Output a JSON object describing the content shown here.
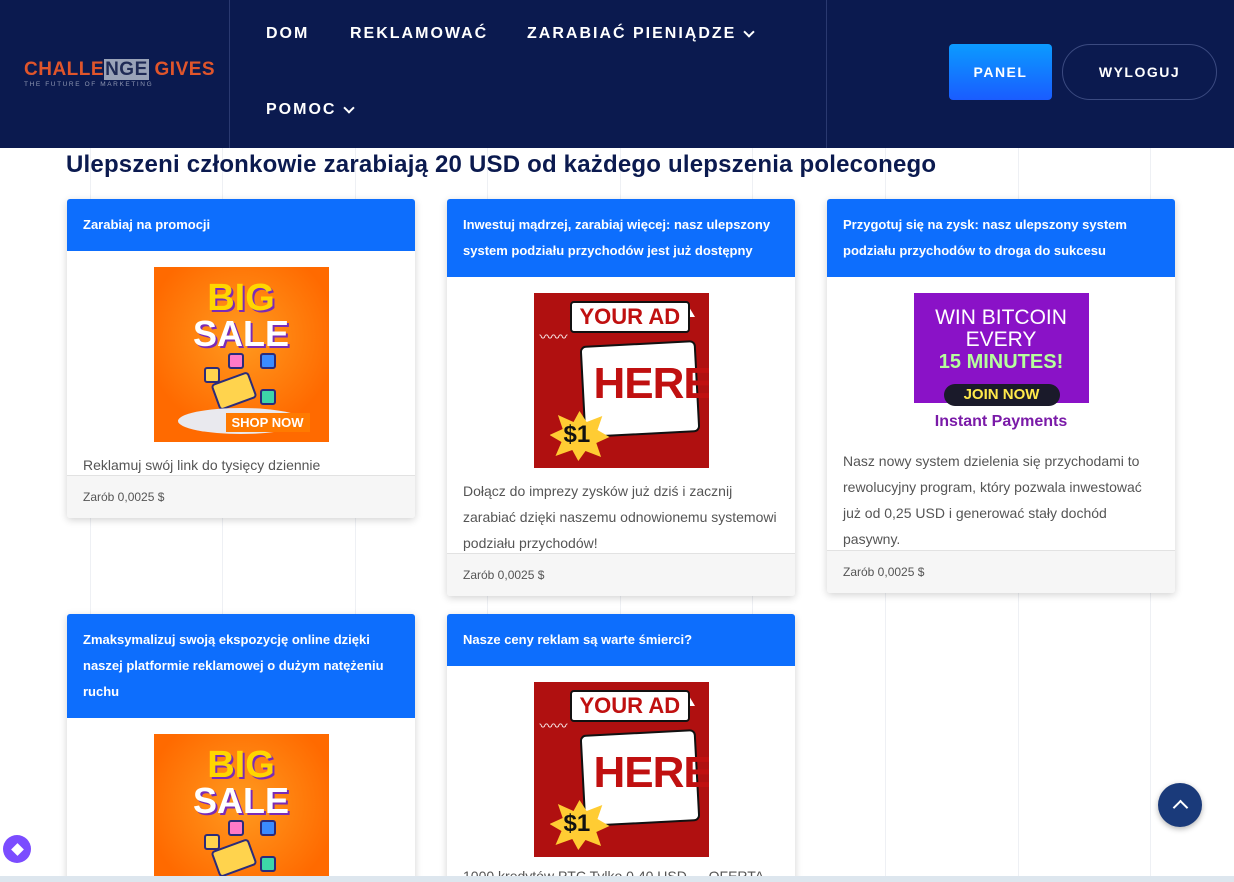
{
  "brand": {
    "logo_part1": "CHALLE",
    "logo_part2": "NGE",
    "logo_part3": "GIVES",
    "tagline": "THE FUTURE OF MARKETING"
  },
  "nav": {
    "home": "DOM",
    "advertise": "REKLAMOWAĆ",
    "earn": "ZARABIAĆ PIENIĄDZE",
    "help": "POMOC",
    "panel": "PANEL",
    "logout": "WYLOGUJ"
  },
  "page": {
    "title": "Ulepszeni członkowie zarabiają 20 USD od każdego ulepszenia poleconego"
  },
  "ads": {
    "sale_big": "BIG",
    "sale_sale": "SALE",
    "sale_shop": "SHOP NOW",
    "here_your_ad": "YOUR AD",
    "here_here": "HERE",
    "here_dollar": "$1",
    "btc_line1": "WIN BITCOIN",
    "btc_line2": "EVERY",
    "btc_line3": "15 MINUTES!",
    "btc_join": "JOIN NOW",
    "btc_instant": "Instant Payments"
  },
  "cards": [
    {
      "title": "Zarabiaj na promocji",
      "text": "Reklamuj swój link do tysięcy dziennie",
      "reward": "Zarób 0,0025 $"
    },
    {
      "title": "Inwestuj mądrzej, zarabiaj więcej: nasz ulepszony system podziału przychodów jest już dostępny",
      "text": "Dołącz do imprezy zysków już dziś i zacznij zarabiać dzięki naszemu odnowionemu systemowi podziału przychodów!",
      "reward": "Zarób 0,0025 $"
    },
    {
      "title": "Przygotuj się na zysk: nasz ulepszony system podziału przychodów to droga do sukcesu",
      "text": "Nasz nowy system dzielenia się przychodami to rewolucyjny program, który pozwala inwestować już od 0,25 USD i generować stały dochód pasywny.",
      "reward": "Zarób 0,0025 $"
    },
    {
      "title": "Zmaksymalizuj swoją ekspozycję online dzięki naszej platformie reklamowej o dużym natężeniu ruchu",
      "text": "",
      "reward": ""
    },
    {
      "title": "Nasze ceny reklam są warte śmierci?",
      "text": "1000 kredytów PTC Tylko 0,40 USD — OFERTA",
      "reward": ""
    }
  ],
  "colors": {
    "header_bg": "#0b1a4f",
    "card_header": "#0d6efd",
    "accent_orange": "#e0552b"
  },
  "icons": [
    "chevron-down-icon",
    "arrow-up-icon",
    "diamond-icon"
  ]
}
